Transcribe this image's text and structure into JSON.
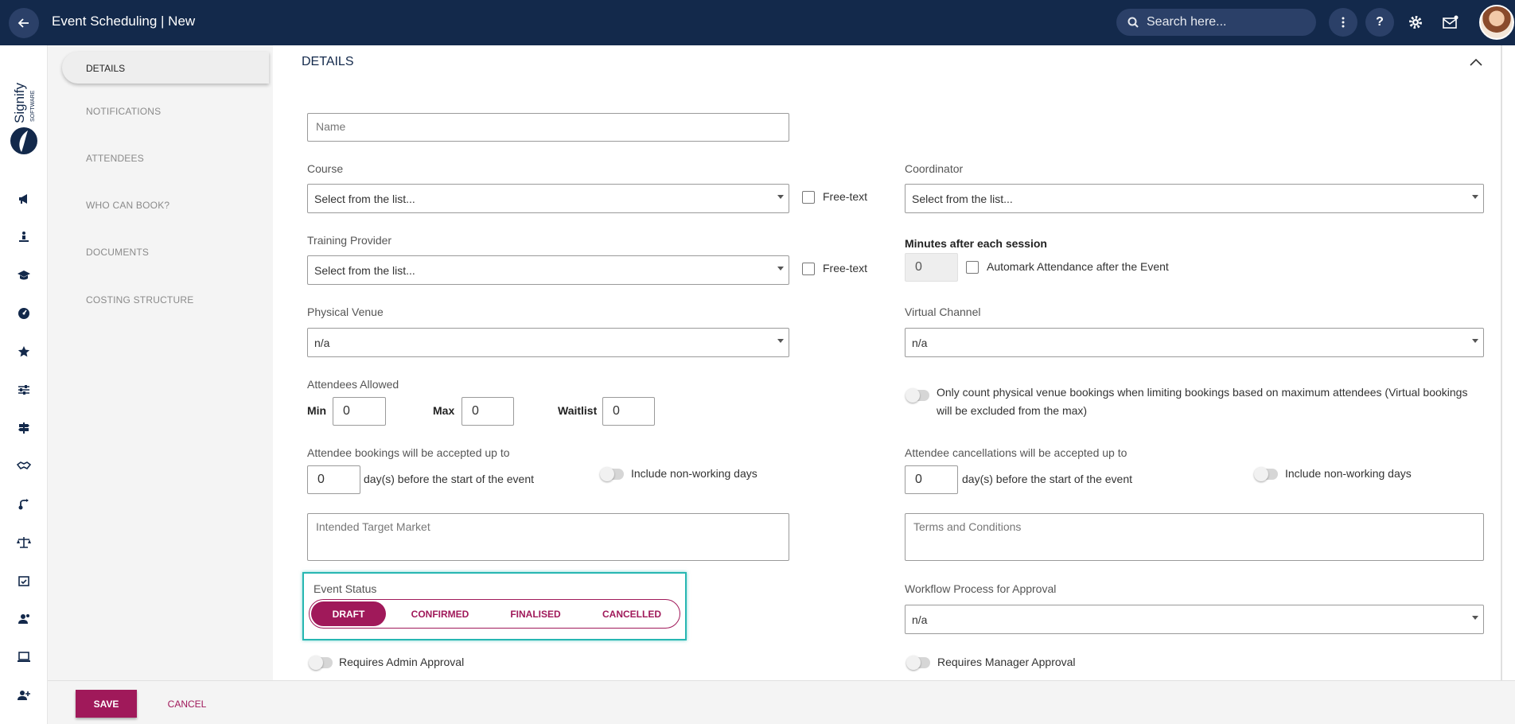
{
  "header": {
    "back_icon": "arrow-left-icon",
    "title": "Event Scheduling | New",
    "search_placeholder": "Search here...",
    "icons": [
      "more-vertical-icon",
      "help-icon",
      "gear-icon",
      "mail-icon",
      "avatar"
    ]
  },
  "logo": {
    "brand": "Signify",
    "sub": "SOFTWARE"
  },
  "rail": {
    "icons": [
      "megaphone-icon",
      "presenter-icon",
      "graduation-cap-icon",
      "gauge-icon",
      "star-icon",
      "sliders-icon",
      "signpost-icon",
      "handshake-icon",
      "route-icon",
      "scales-icon",
      "calendar-check-icon",
      "user-badge-icon",
      "laptop-icon",
      "user-plus-icon"
    ]
  },
  "nav": {
    "items": [
      "DETAILS",
      "NOTIFICATIONS",
      "ATTENDEES",
      "WHO CAN BOOK?",
      "DOCUMENTS",
      "COSTING STRUCTURE"
    ],
    "active": "DETAILS"
  },
  "section": {
    "title": "DETAILS"
  },
  "form": {
    "name_placeholder": "Name",
    "course_label": "Course",
    "course_value": "Select from the list...",
    "course_freetext_label": "Free-text",
    "coordinator_label": "Coordinator",
    "coordinator_value": "Select from the list...",
    "provider_label": "Training Provider",
    "provider_value": "Select from the list...",
    "provider_freetext_label": "Free-text",
    "minutes_label": "Minutes after each session",
    "minutes_value": "0",
    "automark_label": "Automark Attendance after the Event",
    "venue_label": "Physical Venue",
    "venue_value": "n/a",
    "channel_label": "Virtual Channel",
    "channel_value": "n/a",
    "attendees_label": "Attendees Allowed",
    "min_label": "Min",
    "min_value": "0",
    "max_label": "Max",
    "max_value": "0",
    "waitlist_label": "Waitlist",
    "waitlist_value": "0",
    "physical_count_label": "Only count physical venue bookings when limiting bookings based on maximum attendees (Virtual bookings will be excluded from the max)",
    "booking_label": "Attendee bookings will be accepted up to",
    "booking_days": "0",
    "booking_suffix": "day(s) before the start of the event",
    "booking_nonworking": "Include non-working days",
    "cancel_label": "Attendee cancellations will be accepted up to",
    "cancel_days": "0",
    "cancel_suffix": "day(s) before the start of the event",
    "cancel_nonworking": "Include non-working days",
    "target_market_placeholder": "Intended Target Market",
    "terms_placeholder": "Terms and Conditions",
    "status_label": "Event Status",
    "status_options": [
      "DRAFT",
      "CONFIRMED",
      "FINALISED",
      "CANCELLED"
    ],
    "status_selected": "DRAFT",
    "workflow_label": "Workflow Process for Approval",
    "workflow_value": "n/a",
    "admin_approval_label": "Requires Admin Approval",
    "manager_approval_label": "Requires Manager Approval"
  },
  "footer": {
    "save_label": "SAVE",
    "cancel_label": "CANCEL"
  },
  "colors": {
    "header_bg": "#13294b",
    "accent": "#a0195a",
    "highlight": "#27b7b2"
  }
}
